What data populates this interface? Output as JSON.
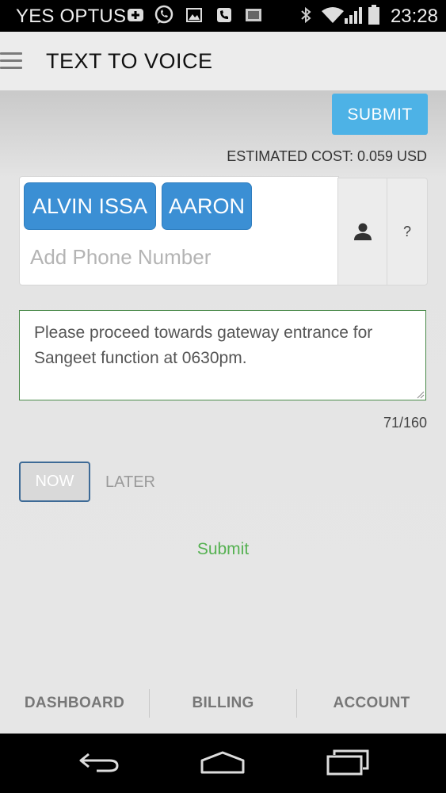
{
  "status_bar": {
    "carrier": "YES OPTUS",
    "time": "23:28",
    "icons": [
      "add-box-icon",
      "whatsapp-icon",
      "image-icon",
      "voip-call-icon",
      "media-icon",
      "bluetooth-icon",
      "wifi-icon",
      "signal-icon",
      "battery-icon"
    ]
  },
  "app_bar": {
    "menu_icon": "hamburger-menu-icon",
    "title": "TEXT TO VOICE"
  },
  "form": {
    "submit_top_label": "SUBMIT",
    "estimated_cost": "ESTIMATED COST: 0.059 USD",
    "recipients": [
      {
        "label": "ALVIN ISSA"
      },
      {
        "label": "AARON"
      }
    ],
    "phone_placeholder": "Add Phone Number",
    "contact_button_icon": "person-icon",
    "help_button_label": "?",
    "message": "Please proceed towards gateway entrance for Sangeet function at 0630pm.",
    "char_count": "71/160",
    "schedule": {
      "now_label": "NOW",
      "later_label": "LATER",
      "selected": "NOW"
    },
    "submit_link_label": "Submit"
  },
  "bottom_nav": {
    "items": [
      {
        "label": "DASHBOARD"
      },
      {
        "label": "BILLING"
      },
      {
        "label": "ACCOUNT"
      }
    ]
  },
  "colors": {
    "accent_blue": "#4db2e6",
    "chip_blue": "#3b8fd4",
    "submit_green": "#55b151",
    "message_border": "#4a8a4a"
  }
}
